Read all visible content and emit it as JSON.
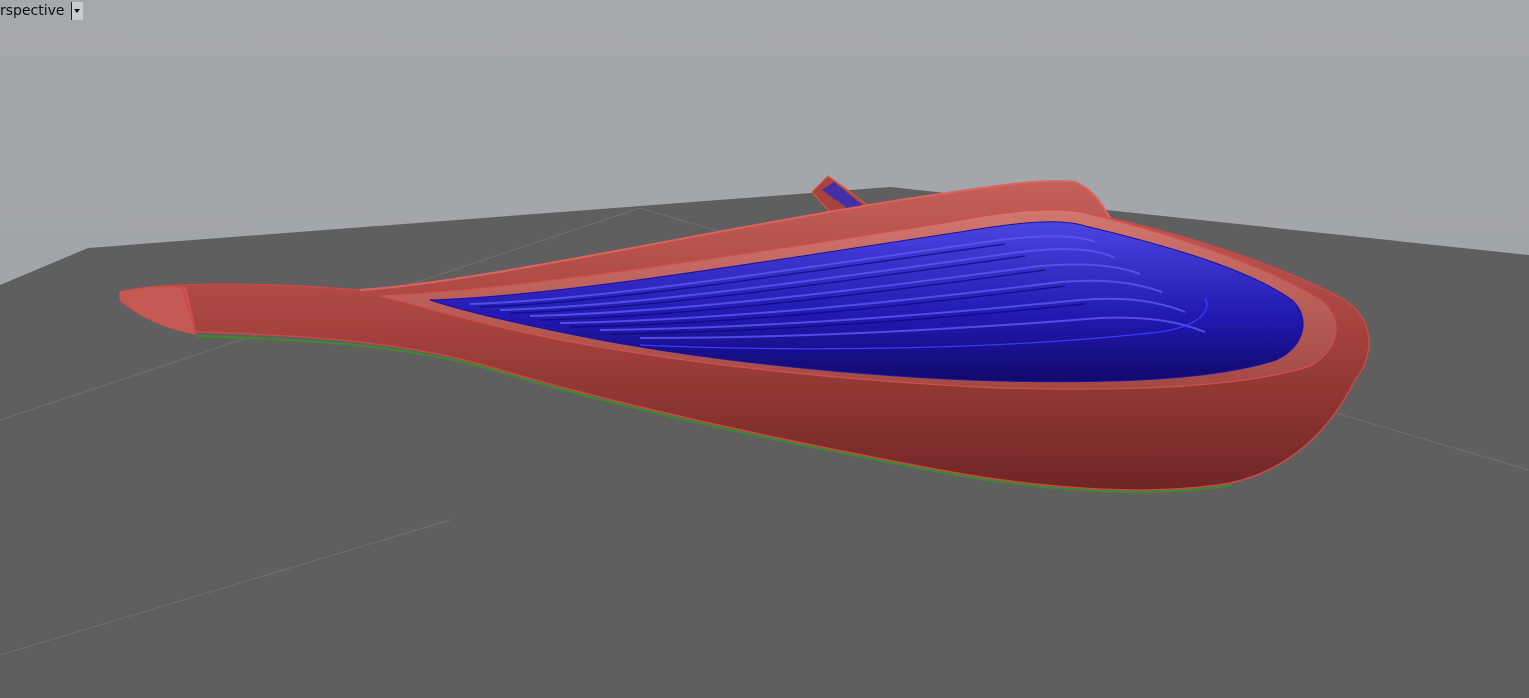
{
  "viewport": {
    "title": "rspective",
    "menu_icon": "chevron-down-icon"
  },
  "scene": {
    "background_color": "#a3a6a9",
    "ground_color": "#5f5f60",
    "grid_line_color": "#6d6e70",
    "objects": [
      {
        "name": "red-shell-surface",
        "color": "#b8504c"
      },
      {
        "name": "blue-ribbed-surface",
        "color": "#2a22c8"
      },
      {
        "name": "green-base-edge",
        "color": "#3a7a2a"
      }
    ]
  }
}
